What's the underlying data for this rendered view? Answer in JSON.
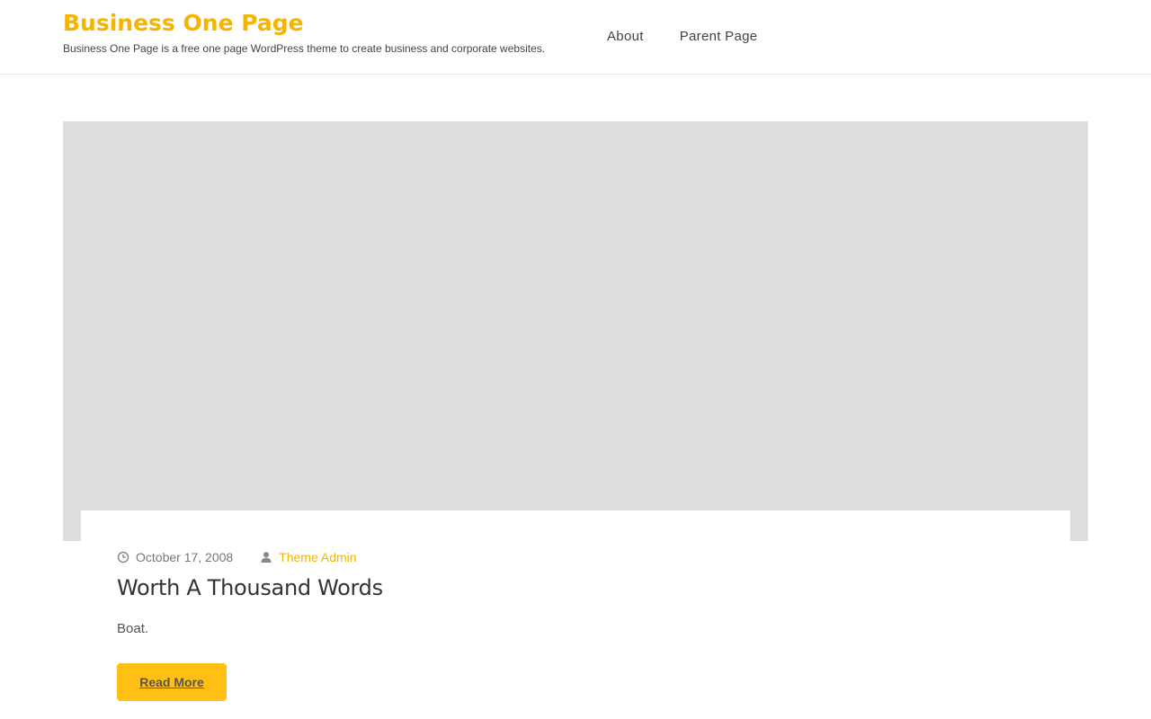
{
  "header": {
    "site_title": "Business One Page",
    "site_description": "Business One Page is a free one page WordPress theme to create business and corporate websites.",
    "nav": [
      {
        "label": "About"
      },
      {
        "label": "Parent Page"
      }
    ]
  },
  "post": {
    "date": "October 17, 2008",
    "author": "Theme Admin",
    "title": "Worth A Thousand Words",
    "excerpt": "Boat.",
    "read_more_label": "Read More",
    "icons": {
      "date": "clock-icon",
      "author": "user-icon"
    }
  },
  "colors": {
    "accent": "#f4b400",
    "button": "#ffbf13",
    "image_placeholder": "#dddddd"
  }
}
